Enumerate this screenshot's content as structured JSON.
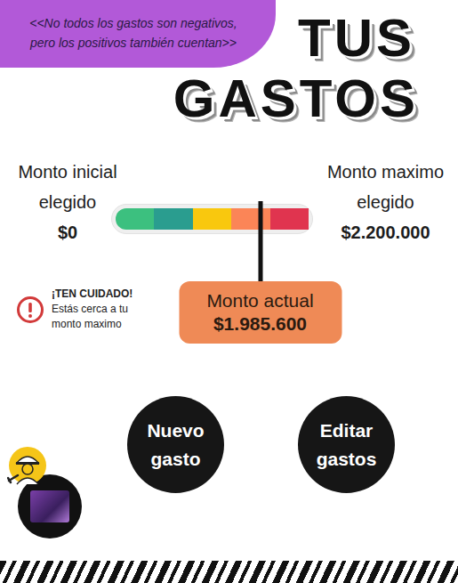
{
  "tagline": {
    "lines": [
      "<<No todos los gastos son negativos,",
      "pero los positivos también cuentan>>"
    ]
  },
  "title": {
    "lines": [
      "TUS",
      "GASTOS"
    ]
  },
  "limits": [
    {
      "kind": "min",
      "label_lines": [
        "Monto inicial",
        "elegido"
      ],
      "value": "$0"
    },
    {
      "kind": "max",
      "label_lines": [
        "Monto maximo",
        "elegido"
      ],
      "value": "$2.200.000"
    }
  ],
  "gauge": {
    "level": 0.74,
    "segments": [
      {
        "color": "#3cc07f"
      },
      {
        "color": "#2a9d8f"
      },
      {
        "color": "#f9c80e"
      },
      {
        "color": "#fb8557"
      },
      {
        "color": "#e0344f"
      }
    ]
  },
  "current": {
    "label": "Monto actual",
    "value": "$1.985.600"
  },
  "warning": {
    "lines": [
      "¡TEN CUIDADO!",
      "Estás cerca a tu",
      "monto maximo"
    ]
  },
  "buttons": [
    {
      "label": "Nuevo gasto"
    },
    {
      "label": "Editar gastos"
    }
  ]
}
